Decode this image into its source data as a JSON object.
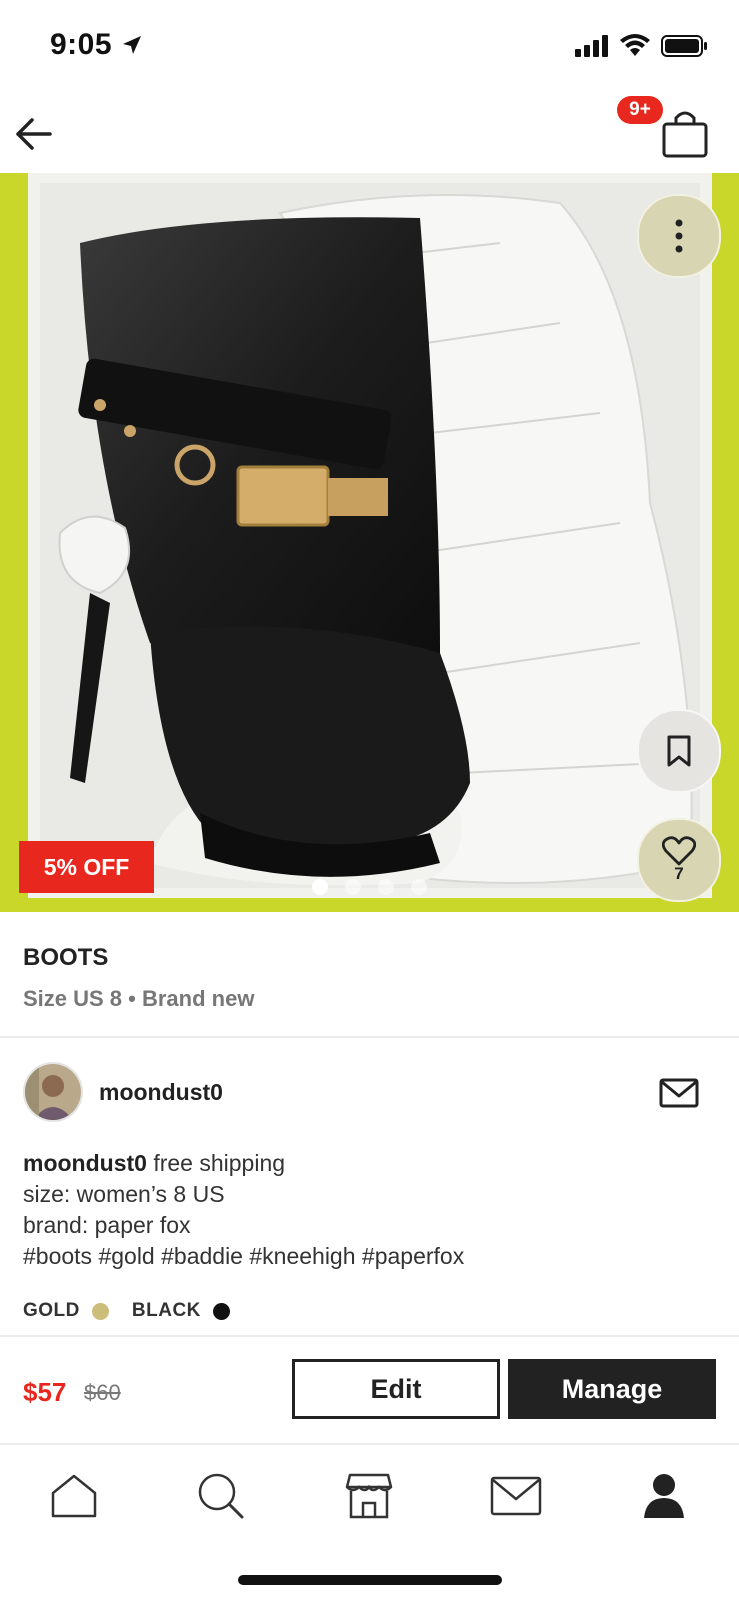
{
  "status_bar": {
    "time": "9:05"
  },
  "header": {
    "cart_badge": "9+"
  },
  "listing": {
    "discount_badge": "5% OFF",
    "likes": "7",
    "photo_count": 4,
    "active_photo": 1,
    "title": "BOOTS",
    "subtitle": "Size US 8 • Brand new"
  },
  "seller": {
    "username": "moondust0"
  },
  "description": {
    "author": "moondust0",
    "first_line": " free shipping",
    "lines": [
      "size: women’s 8 US",
      "brand: paper fox",
      "#boots #gold #baddie #kneehigh #paperfox"
    ]
  },
  "colors": [
    {
      "label": "GOLD",
      "swatch": "#cdbd7a"
    },
    {
      "label": "BLACK",
      "swatch": "#111111"
    }
  ],
  "pricing": {
    "price": "$57",
    "original_price": "$60"
  },
  "actions": {
    "edit_label": "Edit",
    "manage_label": "Manage"
  },
  "tabs": [
    "home-icon",
    "search-icon",
    "shop-icon",
    "inbox-icon",
    "profile-icon"
  ],
  "accent_color": "#e8281e"
}
